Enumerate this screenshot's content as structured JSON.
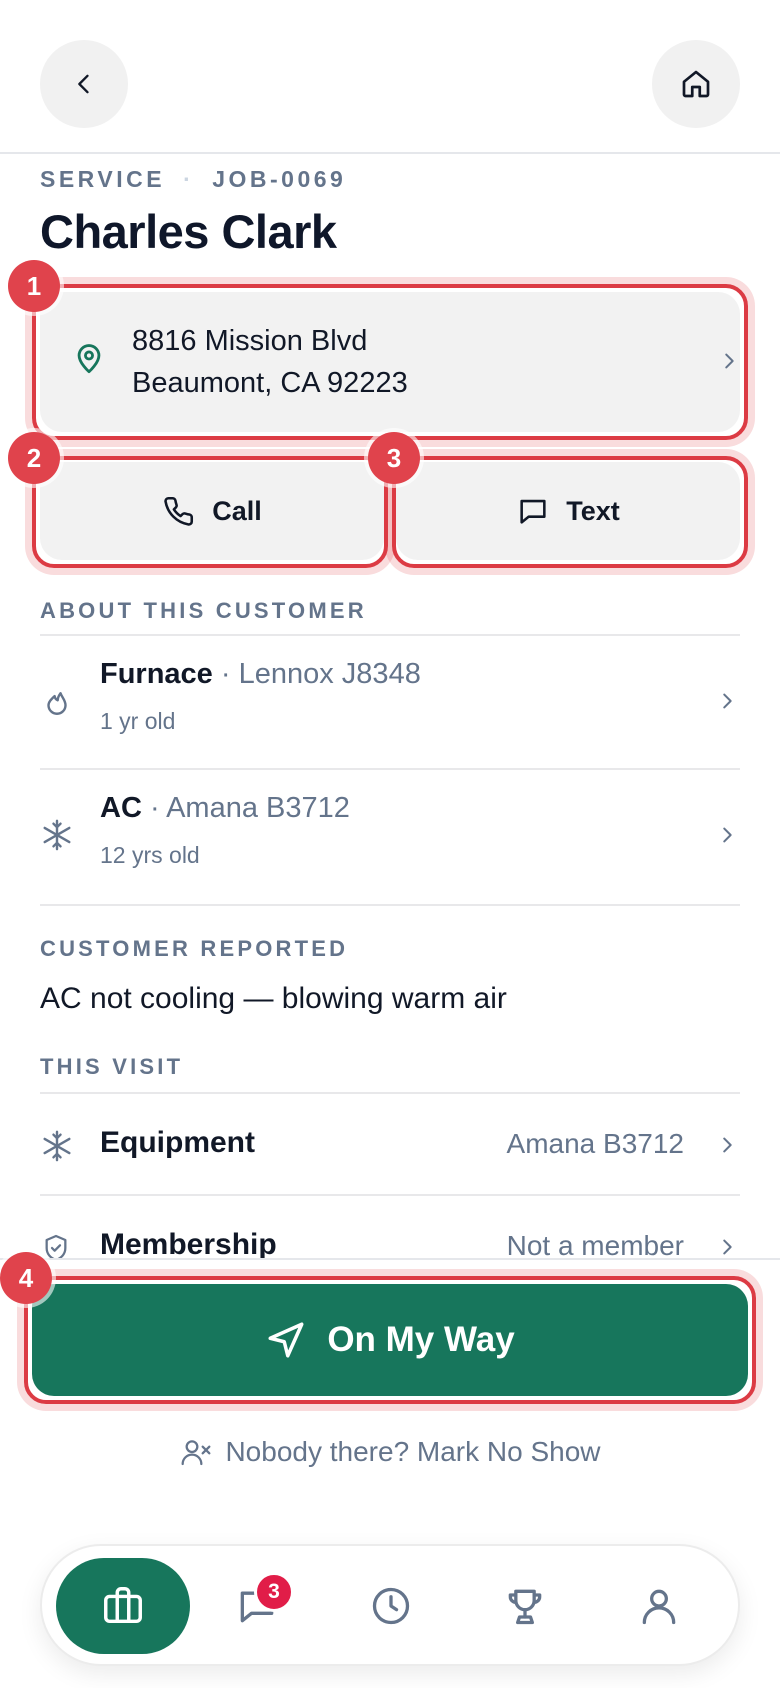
{
  "header": {
    "back_icon": "chevron-left-icon",
    "home_icon": "home-icon"
  },
  "job": {
    "type": "SERVICE",
    "separator": "·",
    "number": "JOB-0069",
    "customer_name": "Charles Clark"
  },
  "address": {
    "line1": "8816 Mission Blvd",
    "line2": "Beaumont, CA 92223",
    "icon": "map-pin-icon"
  },
  "actions": {
    "call_label": "Call",
    "text_label": "Text"
  },
  "about": {
    "section_label": "ABOUT THIS CUSTOMER",
    "equipment": [
      {
        "name": "Furnace",
        "sep": " · ",
        "model": "Lennox J8348",
        "age": "1 yr old",
        "icon": "flame-icon"
      },
      {
        "name": "AC",
        "sep": " · ",
        "model": "Amana B3712",
        "age": "12 yrs old",
        "icon": "snowflake-icon"
      }
    ]
  },
  "reported": {
    "section_label": "CUSTOMER REPORTED",
    "text": "AC not cooling — blowing warm air"
  },
  "visit": {
    "section_label": "THIS VISIT",
    "rows": [
      {
        "label": "Equipment",
        "value": "Amana B3712",
        "icon": "snowflake-icon"
      },
      {
        "label": "Membership",
        "value": "Not a member",
        "icon": "shield-check-icon"
      }
    ]
  },
  "cta": {
    "label": "On My Way",
    "noshow_label": "Nobody there? Mark No Show"
  },
  "annotations": {
    "badges": [
      "1",
      "2",
      "3",
      "4"
    ]
  },
  "tabbar": {
    "messages_badge": "3",
    "tabs": [
      "briefcase-icon",
      "message-icon",
      "clock-icon",
      "trophy-icon",
      "user-icon"
    ]
  },
  "colors": {
    "brand_green": "#17765c",
    "annotation_red": "#dc3b44",
    "badge_pink": "#e11d48",
    "muted": "#64748b"
  }
}
